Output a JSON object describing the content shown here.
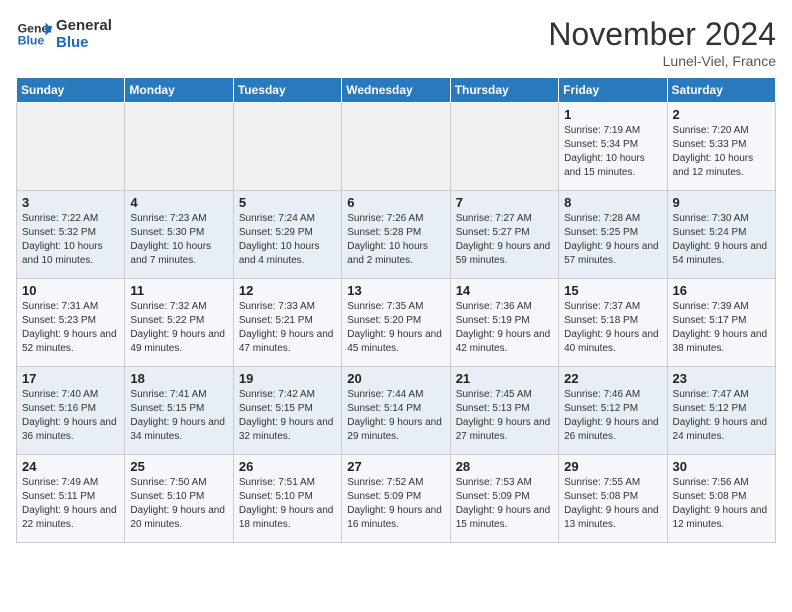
{
  "logo": {
    "line1": "General",
    "line2": "Blue"
  },
  "title": "November 2024",
  "subtitle": "Lunel-Viel, France",
  "days_of_week": [
    "Sunday",
    "Monday",
    "Tuesday",
    "Wednesday",
    "Thursday",
    "Friday",
    "Saturday"
  ],
  "weeks": [
    [
      {
        "day": "",
        "info": ""
      },
      {
        "day": "",
        "info": ""
      },
      {
        "day": "",
        "info": ""
      },
      {
        "day": "",
        "info": ""
      },
      {
        "day": "",
        "info": ""
      },
      {
        "day": "1",
        "info": "Sunrise: 7:19 AM\nSunset: 5:34 PM\nDaylight: 10 hours and 15 minutes."
      },
      {
        "day": "2",
        "info": "Sunrise: 7:20 AM\nSunset: 5:33 PM\nDaylight: 10 hours and 12 minutes."
      }
    ],
    [
      {
        "day": "3",
        "info": "Sunrise: 7:22 AM\nSunset: 5:32 PM\nDaylight: 10 hours and 10 minutes."
      },
      {
        "day": "4",
        "info": "Sunrise: 7:23 AM\nSunset: 5:30 PM\nDaylight: 10 hours and 7 minutes."
      },
      {
        "day": "5",
        "info": "Sunrise: 7:24 AM\nSunset: 5:29 PM\nDaylight: 10 hours and 4 minutes."
      },
      {
        "day": "6",
        "info": "Sunrise: 7:26 AM\nSunset: 5:28 PM\nDaylight: 10 hours and 2 minutes."
      },
      {
        "day": "7",
        "info": "Sunrise: 7:27 AM\nSunset: 5:27 PM\nDaylight: 9 hours and 59 minutes."
      },
      {
        "day": "8",
        "info": "Sunrise: 7:28 AM\nSunset: 5:25 PM\nDaylight: 9 hours and 57 minutes."
      },
      {
        "day": "9",
        "info": "Sunrise: 7:30 AM\nSunset: 5:24 PM\nDaylight: 9 hours and 54 minutes."
      }
    ],
    [
      {
        "day": "10",
        "info": "Sunrise: 7:31 AM\nSunset: 5:23 PM\nDaylight: 9 hours and 52 minutes."
      },
      {
        "day": "11",
        "info": "Sunrise: 7:32 AM\nSunset: 5:22 PM\nDaylight: 9 hours and 49 minutes."
      },
      {
        "day": "12",
        "info": "Sunrise: 7:33 AM\nSunset: 5:21 PM\nDaylight: 9 hours and 47 minutes."
      },
      {
        "day": "13",
        "info": "Sunrise: 7:35 AM\nSunset: 5:20 PM\nDaylight: 9 hours and 45 minutes."
      },
      {
        "day": "14",
        "info": "Sunrise: 7:36 AM\nSunset: 5:19 PM\nDaylight: 9 hours and 42 minutes."
      },
      {
        "day": "15",
        "info": "Sunrise: 7:37 AM\nSunset: 5:18 PM\nDaylight: 9 hours and 40 minutes."
      },
      {
        "day": "16",
        "info": "Sunrise: 7:39 AM\nSunset: 5:17 PM\nDaylight: 9 hours and 38 minutes."
      }
    ],
    [
      {
        "day": "17",
        "info": "Sunrise: 7:40 AM\nSunset: 5:16 PM\nDaylight: 9 hours and 36 minutes."
      },
      {
        "day": "18",
        "info": "Sunrise: 7:41 AM\nSunset: 5:15 PM\nDaylight: 9 hours and 34 minutes."
      },
      {
        "day": "19",
        "info": "Sunrise: 7:42 AM\nSunset: 5:15 PM\nDaylight: 9 hours and 32 minutes."
      },
      {
        "day": "20",
        "info": "Sunrise: 7:44 AM\nSunset: 5:14 PM\nDaylight: 9 hours and 29 minutes."
      },
      {
        "day": "21",
        "info": "Sunrise: 7:45 AM\nSunset: 5:13 PM\nDaylight: 9 hours and 27 minutes."
      },
      {
        "day": "22",
        "info": "Sunrise: 7:46 AM\nSunset: 5:12 PM\nDaylight: 9 hours and 26 minutes."
      },
      {
        "day": "23",
        "info": "Sunrise: 7:47 AM\nSunset: 5:12 PM\nDaylight: 9 hours and 24 minutes."
      }
    ],
    [
      {
        "day": "24",
        "info": "Sunrise: 7:49 AM\nSunset: 5:11 PM\nDaylight: 9 hours and 22 minutes."
      },
      {
        "day": "25",
        "info": "Sunrise: 7:50 AM\nSunset: 5:10 PM\nDaylight: 9 hours and 20 minutes."
      },
      {
        "day": "26",
        "info": "Sunrise: 7:51 AM\nSunset: 5:10 PM\nDaylight: 9 hours and 18 minutes."
      },
      {
        "day": "27",
        "info": "Sunrise: 7:52 AM\nSunset: 5:09 PM\nDaylight: 9 hours and 16 minutes."
      },
      {
        "day": "28",
        "info": "Sunrise: 7:53 AM\nSunset: 5:09 PM\nDaylight: 9 hours and 15 minutes."
      },
      {
        "day": "29",
        "info": "Sunrise: 7:55 AM\nSunset: 5:08 PM\nDaylight: 9 hours and 13 minutes."
      },
      {
        "day": "30",
        "info": "Sunrise: 7:56 AM\nSunset: 5:08 PM\nDaylight: 9 hours and 12 minutes."
      }
    ]
  ]
}
